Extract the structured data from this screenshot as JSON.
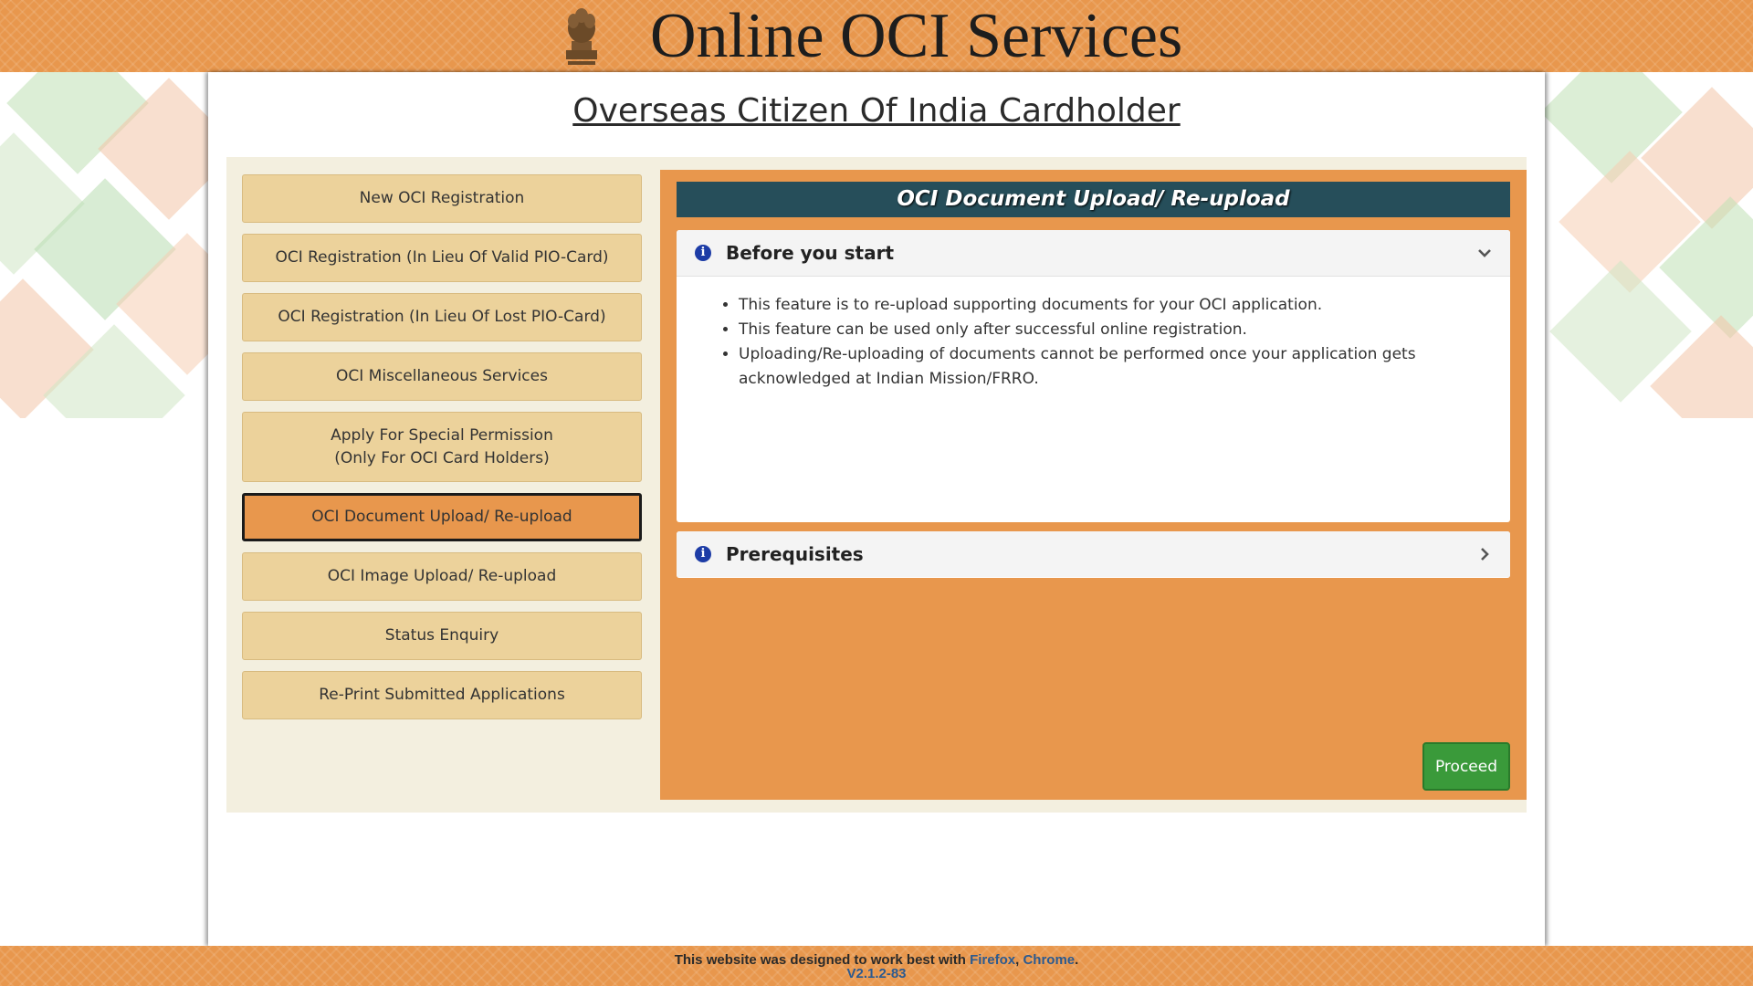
{
  "header": {
    "title": "Online OCI Services"
  },
  "page": {
    "heading": "Overseas Citizen Of India Cardholder"
  },
  "menu": {
    "items": [
      {
        "label": "New OCI Registration"
      },
      {
        "label": "OCI Registration (In Lieu Of Valid PIO-Card)"
      },
      {
        "label": "OCI Registration (In Lieu Of Lost PIO-Card)"
      },
      {
        "label": "OCI Miscellaneous Services"
      },
      {
        "label": "Apply For Special Permission\n(Only For OCI Card Holders)"
      },
      {
        "label": "OCI Document Upload/ Re-upload",
        "active": true
      },
      {
        "label": "OCI Image Upload/ Re-upload"
      },
      {
        "label": "Status Enquiry"
      },
      {
        "label": "Re-Print Submitted Applications"
      }
    ]
  },
  "panel": {
    "title": "OCI Document Upload/ Re-upload",
    "before_you_start": {
      "label": "Before you start",
      "expanded": true,
      "bullets": [
        "This feature is to re-upload supporting documents for your OCI application.",
        "This feature can be used only after successful online registration.",
        "Uploading/Re-uploading of documents cannot be performed once your application gets acknowledged at Indian Mission/FRRO."
      ]
    },
    "prerequisites": {
      "label": "Prerequisites",
      "expanded": false
    },
    "proceed_label": "Proceed"
  },
  "footer": {
    "text_before": "This website was designed to work best with ",
    "link_firefox": "Firefox",
    "separator": ", ",
    "link_chrome": "Chrome",
    "text_after": ".",
    "version": "V2.1.2-83"
  },
  "colors": {
    "header_bg": "#e8974d",
    "menu_button": "#ecd29b",
    "panel_bg": "#e8974d",
    "panel_title_bg": "#264e5a",
    "proceed_button": "#3a9a3a",
    "info_icon": "#1d3ca6"
  },
  "icons": {
    "emblem": "state-emblem-icon",
    "info": "info-icon",
    "expand": "chevron-down-icon",
    "collapse": "chevron-right-icon"
  }
}
